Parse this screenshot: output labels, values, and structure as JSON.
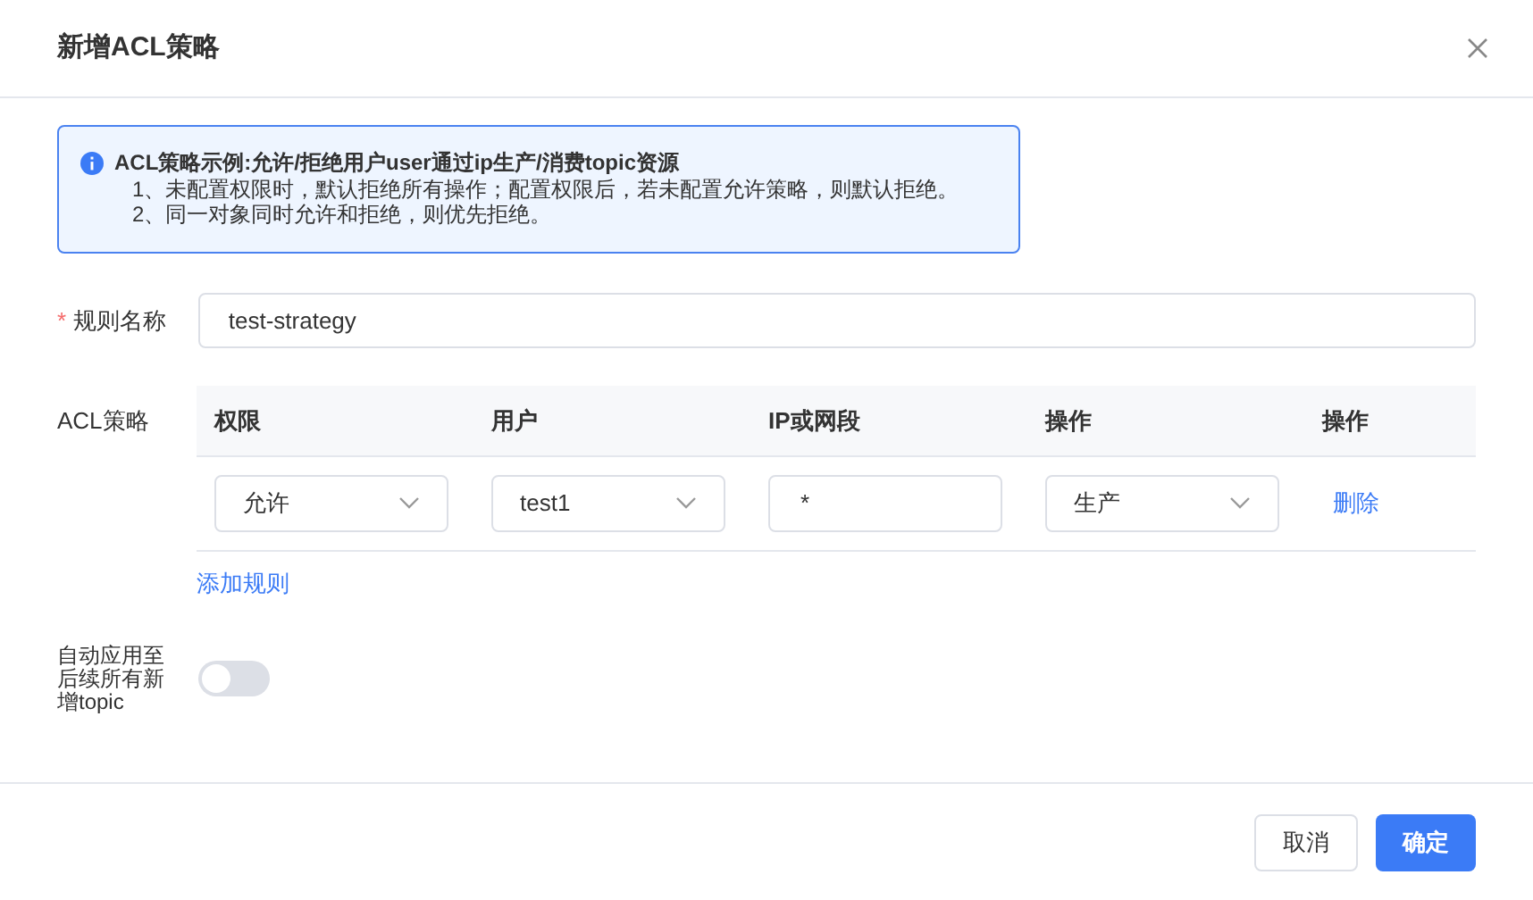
{
  "dialog": {
    "title": "新增ACL策略"
  },
  "alert": {
    "title": "ACL策略示例:允许/拒绝用户user通过ip生产/消费topic资源",
    "lines": [
      "1、未配置权限时，默认拒绝所有操作；配置权限后，若未配置允许策略，则默认拒绝。",
      "2、同一对象同时允许和拒绝，则优先拒绝。"
    ]
  },
  "rule_name": {
    "required_mark": "*",
    "label": "规则名称",
    "value": "test-strategy"
  },
  "acl": {
    "label": "ACL策略",
    "columns": [
      "权限",
      "用户",
      "IP或网段",
      "操作",
      "操作"
    ],
    "rows": [
      {
        "cells": [
          {
            "kind": "select",
            "value": "允许"
          },
          {
            "kind": "select",
            "value": "test1"
          },
          {
            "kind": "input",
            "value": "*"
          },
          {
            "kind": "select",
            "value": "生产"
          },
          {
            "kind": "link",
            "value": "删除"
          }
        ]
      }
    ],
    "add_link": "添加规则"
  },
  "auto_apply": {
    "label": "自动应用至后续所有新增topic",
    "on": false
  },
  "buttons": [
    {
      "label": "取消",
      "kind": "secondary"
    },
    {
      "label": "确定",
      "kind": "primary"
    }
  ]
}
